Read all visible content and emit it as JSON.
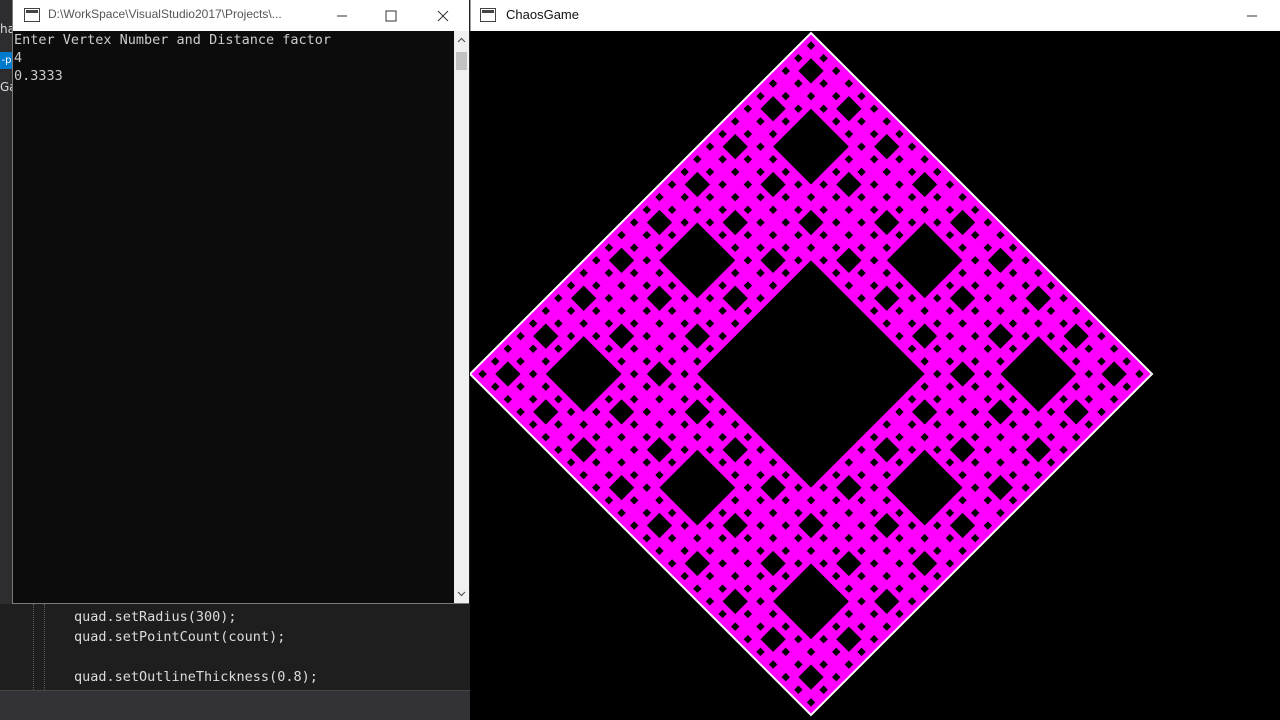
{
  "background_editor": {
    "strip_texts": [
      "ha",
      "Ga"
    ],
    "strip_badge": "-p",
    "code_lines": [
      "quad.setRadius(300);",
      "quad.setPointCount(count);",
      "",
      "quad.setOutlineThickness(0.8);"
    ]
  },
  "console_window": {
    "title": "D:\\WorkSpace\\VisualStudio2017\\Projects\\...",
    "lines": [
      "Enter Vertex Number and Distance factor",
      "4",
      "0.3333"
    ],
    "buttons": {
      "minimize": "—",
      "maximize": "☐",
      "close": "✕"
    }
  },
  "chaos_window": {
    "title": "ChaosGame",
    "buttons": {
      "minimize": "—"
    },
    "fractal": {
      "vertex_count": 4,
      "distance_factor": 0.3333,
      "fill_color": "#ff00ff",
      "outline_color": "#ffffff",
      "background_color": "#000000",
      "levels": 4
    }
  }
}
